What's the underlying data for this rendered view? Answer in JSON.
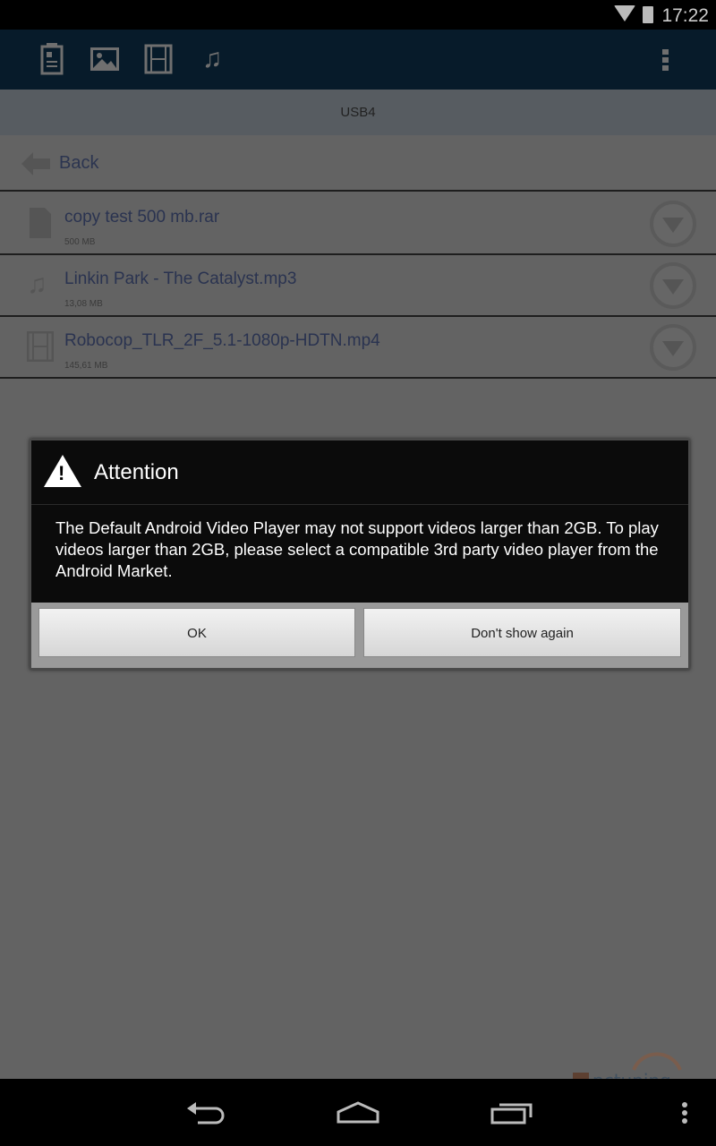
{
  "status_bar": {
    "time": "17:22",
    "icons": [
      "wifi-icon",
      "battery-icon"
    ]
  },
  "toolbar": {
    "icons": [
      "documents-icon",
      "images-icon",
      "videos-icon",
      "music-icon"
    ],
    "overflow": "overflow-menu-icon"
  },
  "path": {
    "title": "USB4"
  },
  "back": {
    "label": "Back"
  },
  "files": [
    {
      "name": "copy test 500 mb.rar",
      "size": "500 MB",
      "icon": "file-icon"
    },
    {
      "name": "Linkin Park - The Catalyst.mp3",
      "size": "13,08 MB",
      "icon": "music-note-icon"
    },
    {
      "name": "Robocop_TLR_2F_5.1-1080p-HDTN.mp4",
      "size": "145,61 MB",
      "icon": "film-icon"
    }
  ],
  "dialog": {
    "title": "Attention",
    "message": "The Default Android Video Player may not support videos larger than 2GB. To play videos larger than 2GB, please select a compatible 3rd party video player from the Android Market.",
    "ok": "OK",
    "dont_show": "Don't show again"
  },
  "watermark": "pctuning",
  "colors": {
    "toolbar": "#071b2a",
    "dialog_bg": "#0b0b0b",
    "file_name": "#2a3350"
  }
}
